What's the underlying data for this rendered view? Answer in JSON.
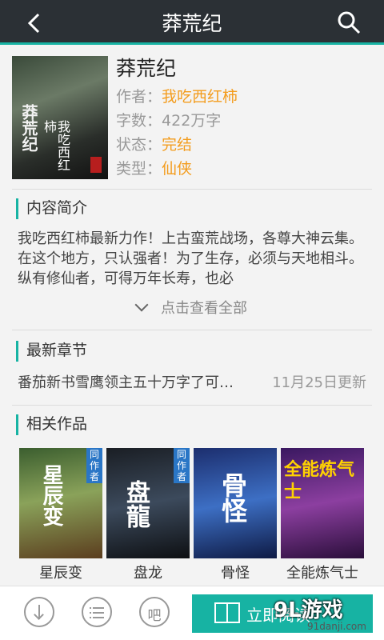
{
  "header": {
    "title": "莽荒纪"
  },
  "book": {
    "cover_title": "莽荒纪",
    "cover_author": "我吃西红柿",
    "title": "莽荒纪",
    "author_label": "作者：",
    "author": "我吃西红柿",
    "words_label": "字数：",
    "words": "422万字",
    "status_label": "状态：",
    "status": "完结",
    "type_label": "类型：",
    "type": "仙侠"
  },
  "intro": {
    "heading": "内容简介",
    "text": "我吃西红柿最新力作！上古蛮荒战场，各尊大神云集。在这个地方，只认强者！为了生存，必须与天地相斗。纵有修仙者，可得万年长寿，也必",
    "more_label": "点击查看全部"
  },
  "latest": {
    "heading": "最新章节",
    "chapter": "番茄新书雪鹰领主五十万字了可…",
    "date": "11月25日更新"
  },
  "related": {
    "heading": "相关作品",
    "tag": "同作者",
    "items": [
      {
        "name": "星辰变",
        "cover_text": "星辰变"
      },
      {
        "name": "盘龙",
        "cover_text": "盘龍"
      },
      {
        "name": "骨怪",
        "cover_text": "骨怪"
      },
      {
        "name": "全能炼气士",
        "cover_text": "全能炼气士"
      }
    ]
  },
  "bottom": {
    "forum_label": "吧",
    "read_label": "立即阅读"
  },
  "watermark": {
    "logo": "9L游戏",
    "site": "91danji.com"
  },
  "colors": {
    "accent": "#17b3a3",
    "header_bg": "#2b3035",
    "highlight": "#f39c1d"
  }
}
